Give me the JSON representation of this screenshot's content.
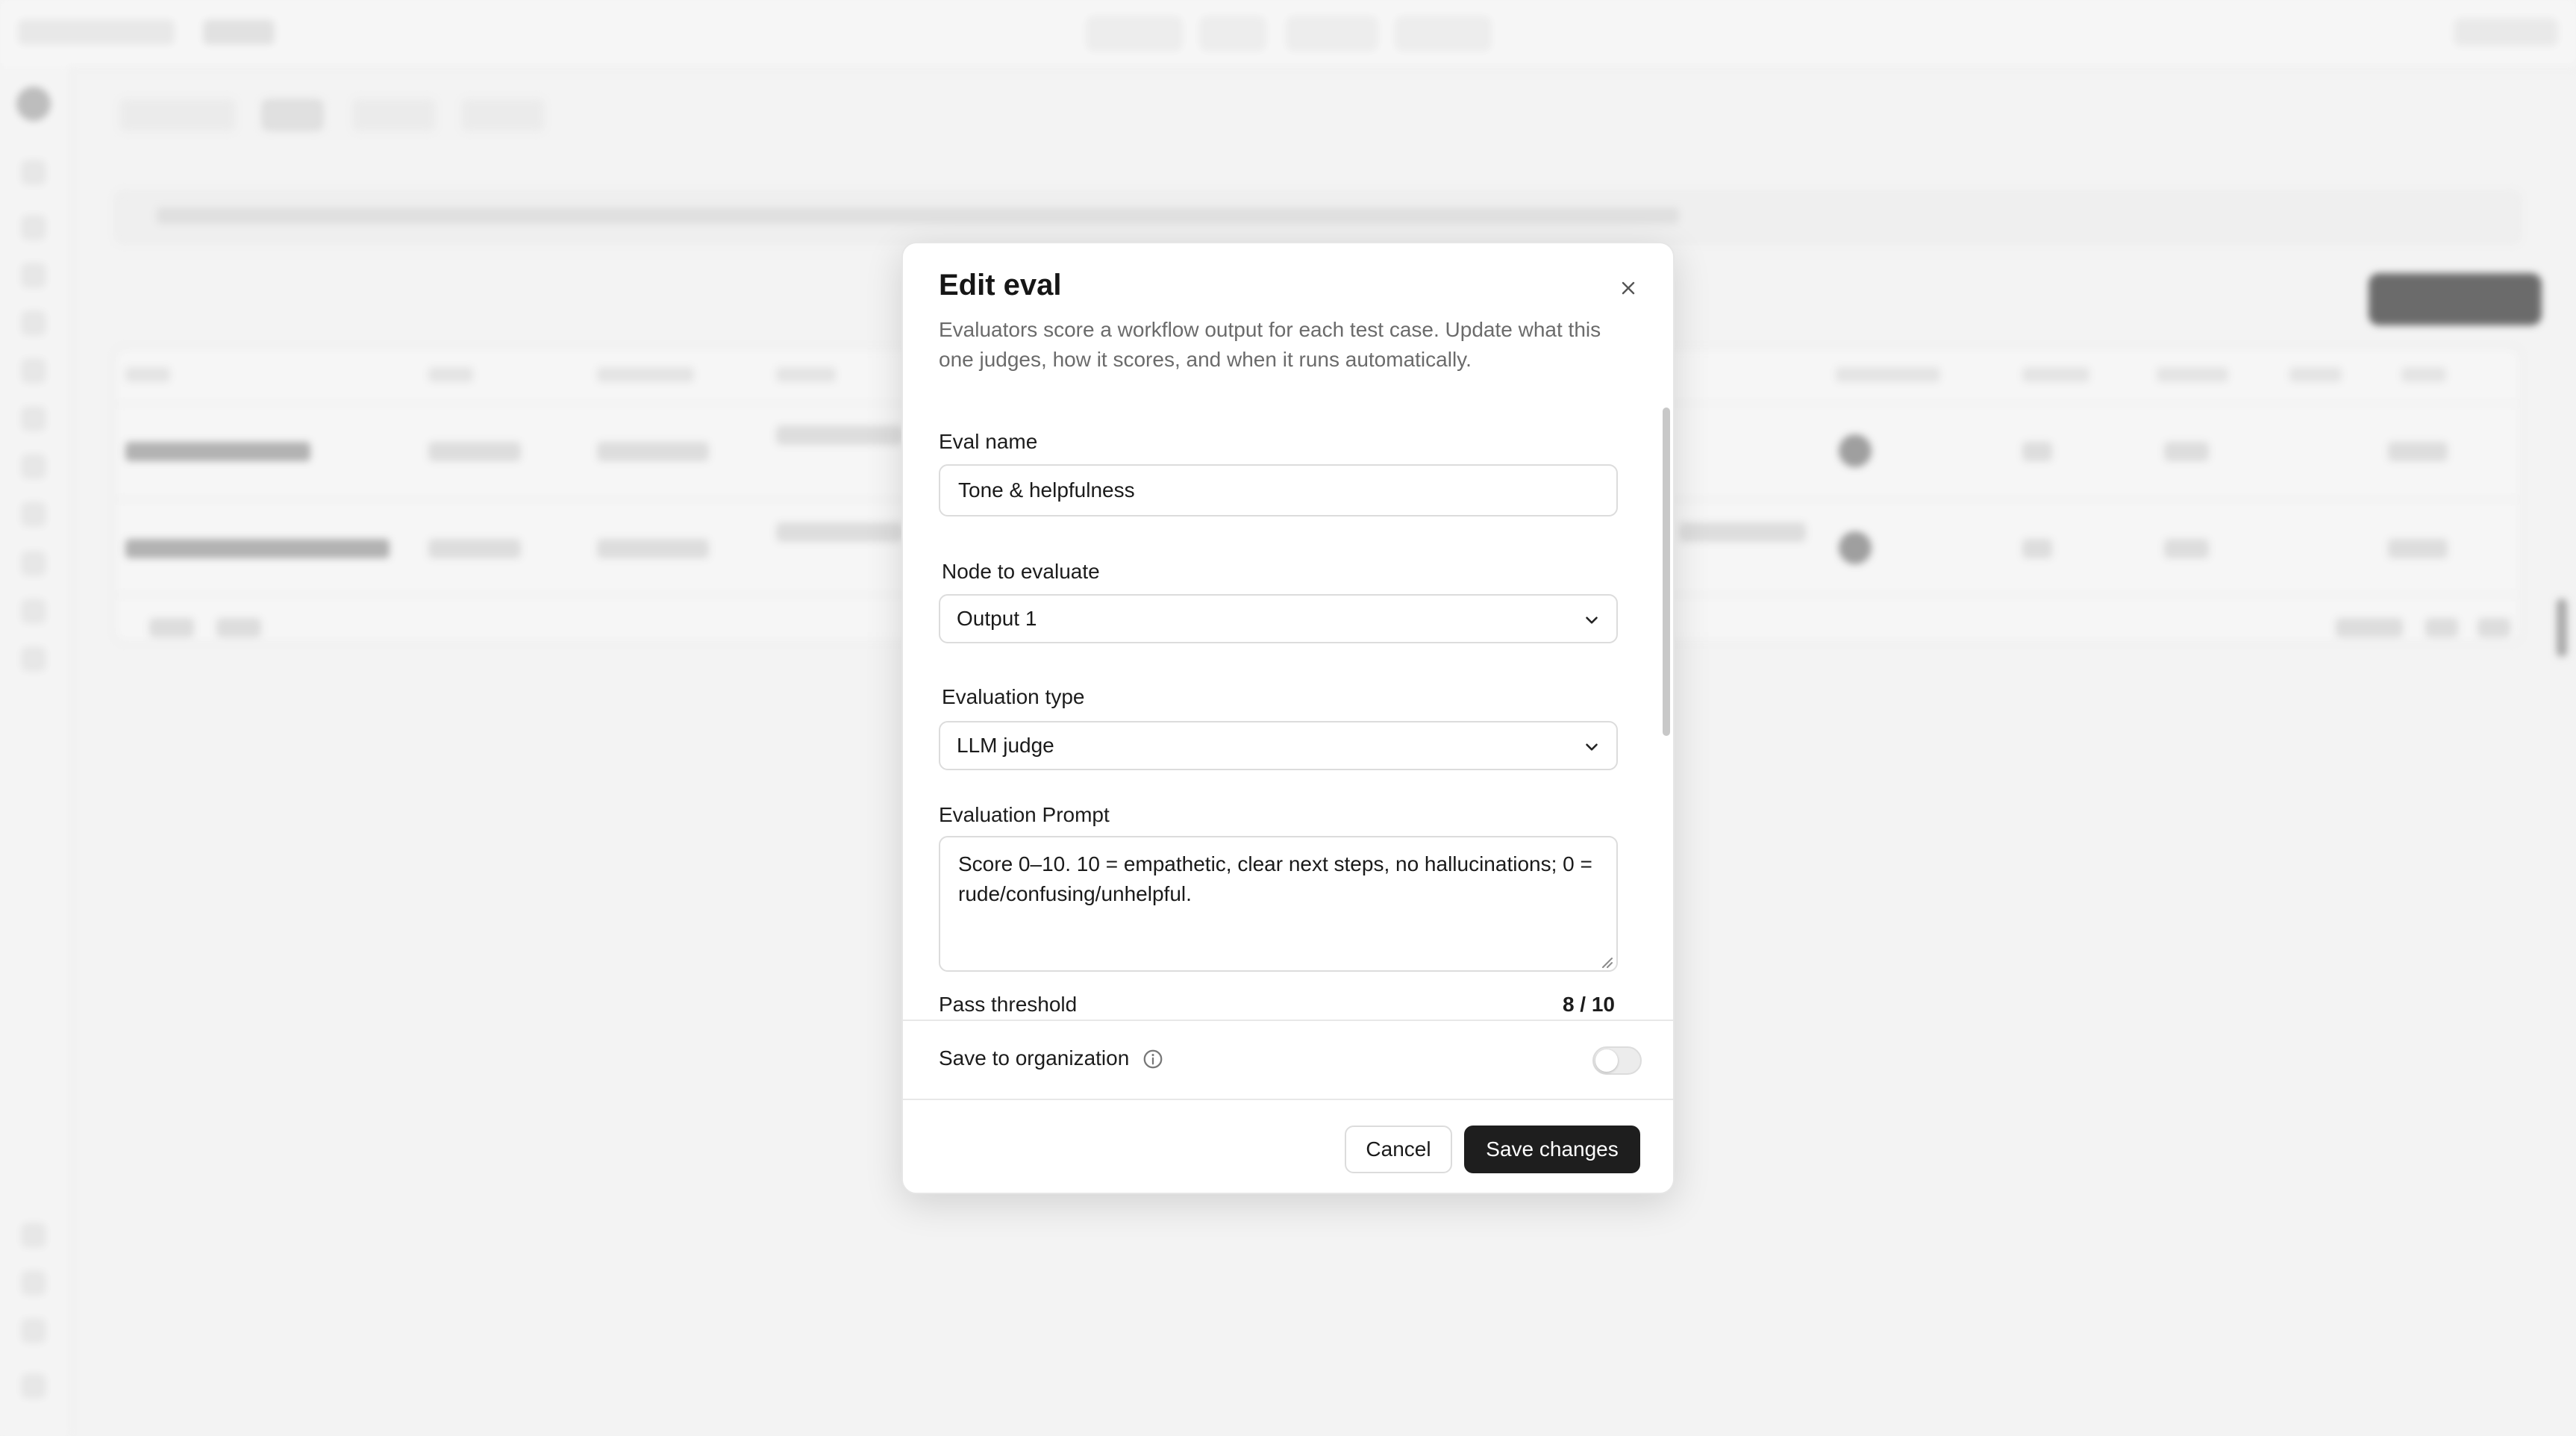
{
  "modal": {
    "title": "Edit eval",
    "description": "Evaluators score a workflow output for each test case. Update what this one judges, how it scores, and when it runs automatically.",
    "close_icon": "close-icon"
  },
  "fields": {
    "eval_name": {
      "label": "Eval name",
      "value": "Tone & helpfulness"
    },
    "node": {
      "label": "Node to evaluate",
      "selected": "Output 1"
    },
    "eval_type": {
      "label": "Evaluation type",
      "selected": "LLM judge"
    },
    "prompt": {
      "label": "Evaluation Prompt",
      "value": "Score 0–10. 10 = empathetic, clear next steps, no hallucinations; 0 = rude/confusing/unhelpful."
    },
    "threshold": {
      "label": "Pass threshold",
      "value": "8 / 10"
    }
  },
  "organization": {
    "label": "Save to organization",
    "icon": "info-icon",
    "enabled": false
  },
  "footer": {
    "cancel_label": "Cancel",
    "save_label": "Save changes"
  },
  "colors": {
    "primary_button": "#1e1e1e",
    "border": "#dcdcdc",
    "muted_text": "#6b6b6b"
  }
}
